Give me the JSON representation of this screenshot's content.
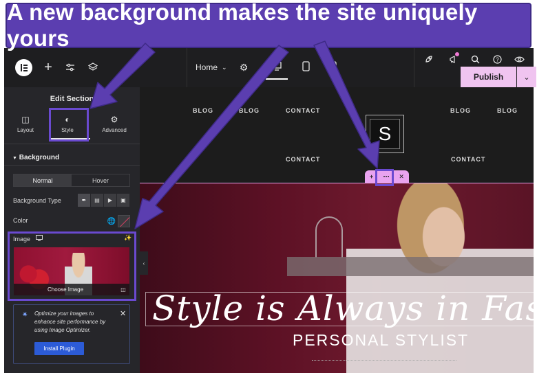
{
  "banner": {
    "text": "A new background makes the site uniquely yours"
  },
  "topbar": {
    "page_name": "Home",
    "publish_label": "Publish"
  },
  "panel": {
    "title": "Edit Section",
    "tabs": [
      {
        "label": "Layout",
        "icon": "layout-icon"
      },
      {
        "label": "Style",
        "icon": "style-icon",
        "active": true
      },
      {
        "label": "Advanced",
        "icon": "gear-icon"
      }
    ],
    "background_heading": "Background",
    "state_tabs": [
      "Normal",
      "Hover"
    ],
    "background_type_label": "Background Type",
    "color_label": "Color",
    "image_label": "Image",
    "choose_image_label": "Choose Image",
    "promo": {
      "text": "Optimize your images to enhance site performance by using Image Optimizer.",
      "button_label": "Install Plugin"
    }
  },
  "canvas": {
    "nav_top": [
      "BLOG",
      "BLOG",
      "CONTACT",
      "BLOG",
      "BLOG"
    ],
    "nav_bottom": [
      "CONTACT",
      "CONTACT"
    ],
    "logo_letter": "S",
    "hero_title": "Style is Always in Fashion",
    "hero_subtitle": "PERSONAL STYLIST"
  },
  "colors": {
    "banner": "#5b3eb0",
    "highlight": "#6a4ad0",
    "publish": "#f0c4f0",
    "editor_dark": "#26262a",
    "install_button": "#2c5bd6"
  }
}
